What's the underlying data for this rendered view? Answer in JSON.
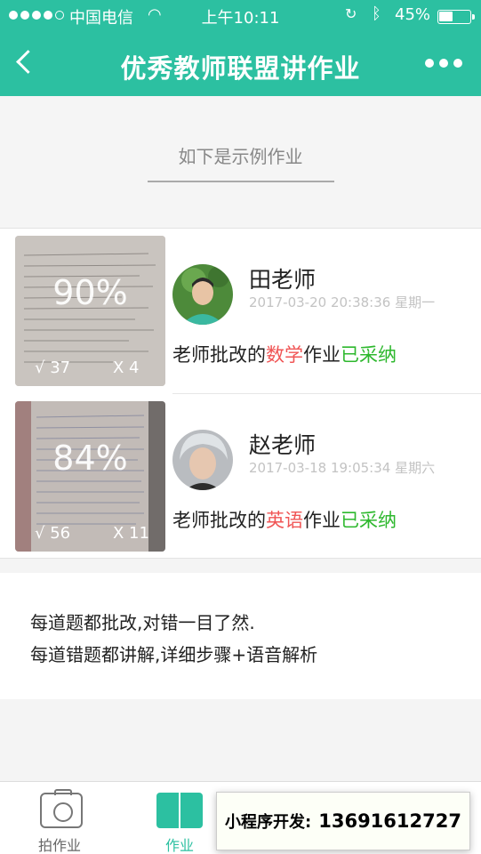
{
  "status_bar": {
    "carrier": "中国电信",
    "time": "上午10:11",
    "battery": "45%"
  },
  "nav": {
    "title": "优秀教师联盟讲作业"
  },
  "example": {
    "text": "如下是示例作业"
  },
  "items": [
    {
      "percent": "90%",
      "correct": "√ 37",
      "wrong": "X 4",
      "teacher": "田老师",
      "date": "2017-03-20 20:38:36 星期一",
      "desc_prefix": "老师批改的",
      "subject": "数学",
      "desc_mid": "作业",
      "status": "已采纳"
    },
    {
      "percent": "84%",
      "correct": "√ 56",
      "wrong": "X 11",
      "teacher": "赵老师",
      "date": "2017-03-18 19:05:34 星期六",
      "desc_prefix": "老师批改的",
      "subject": "英语",
      "desc_mid": "作业",
      "status": "已采纳"
    }
  ],
  "info": {
    "line1": "每道题都批改,对错一目了然.",
    "line2": "每道错题都讲解,详细步骤+语音解析"
  },
  "tabs": [
    {
      "label": "拍作业",
      "icon": "camera-icon"
    },
    {
      "label": "作业",
      "icon": "book-icon"
    }
  ],
  "promo": {
    "label": "小程序开发:",
    "phone": "13691612727"
  },
  "colors": {
    "accent": "#2cc0a1",
    "subject": "#f05555",
    "accepted": "#2eb82e"
  }
}
